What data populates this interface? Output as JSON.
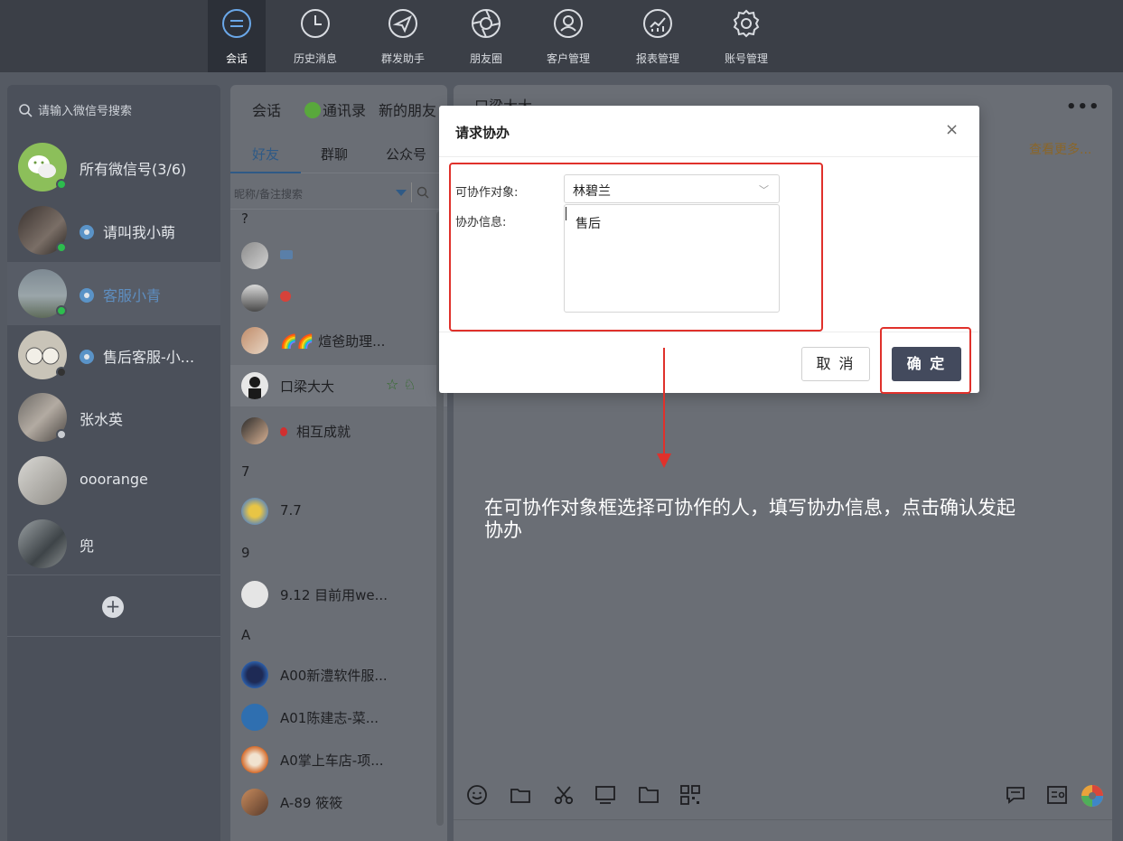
{
  "nav": {
    "items": [
      {
        "label": "会话",
        "icon": "chat-bubble-icon"
      },
      {
        "label": "历史消息",
        "icon": "clock-icon"
      },
      {
        "label": "群发助手",
        "icon": "paper-plane-icon"
      },
      {
        "label": "朋友圈",
        "icon": "aperture-icon"
      },
      {
        "label": "客户管理",
        "icon": "user-circle-icon"
      },
      {
        "label": "报表管理",
        "icon": "chart-icon"
      },
      {
        "label": "账号管理",
        "icon": "gear-icon"
      }
    ]
  },
  "accounts": {
    "search_placeholder": "请输入微信号搜索",
    "all_label": "所有微信号(3/6)",
    "items": [
      {
        "name": "请叫我小萌"
      },
      {
        "name": "客服小青"
      },
      {
        "name": "售后客服-小..."
      },
      {
        "name": "张水英"
      },
      {
        "name": "ooorange"
      },
      {
        "name": "兜"
      }
    ],
    "add_label": "+"
  },
  "contacts": {
    "tabs": [
      "会话",
      "通讯录",
      "新的朋友"
    ],
    "subtabs": [
      "好友",
      "群聊",
      "公众号"
    ],
    "filter_placeholder": "昵称/备注搜索",
    "sections": [
      {
        "letter": "?",
        "items": [
          "",
          "",
          "🌈🌈 煊爸助理...",
          "口梁大大",
          "相互成就"
        ]
      },
      {
        "letter": "7",
        "items": [
          "7.7"
        ]
      },
      {
        "letter": "9",
        "items": [
          "9.12 目前用we..."
        ]
      },
      {
        "letter": "A",
        "items": [
          "A00新澧软件服...",
          "A01陈建志-菜...",
          "A0掌上车店-项...",
          "A-89 筱筱"
        ]
      }
    ]
  },
  "chat": {
    "header_name": "口梁大大",
    "more_label": "•••",
    "view_more": "查看更多..."
  },
  "modal": {
    "title": "请求协办",
    "close": "×",
    "target_label": "可协作对象:",
    "target_value": "林碧兰",
    "info_label": "协办信息:",
    "info_value": "售后",
    "cancel": "取 消",
    "confirm": "确 定"
  },
  "annotation": {
    "text": "在可协作对象框选择可协作的人，填写协办信息，点击确认发起协办",
    "color": "#e0312b"
  }
}
